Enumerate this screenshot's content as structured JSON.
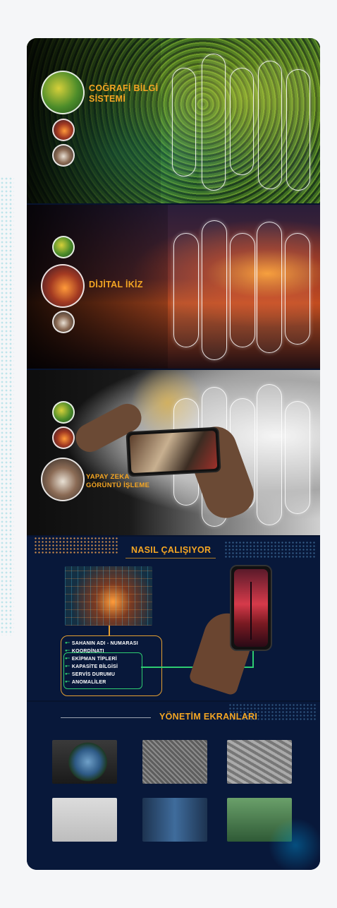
{
  "panels": [
    {
      "title_line1": "COĞRAFİ BİLGİ",
      "title_line2": "SİSTEMİ"
    },
    {
      "title_line1": "DİJİTAL İKİZ"
    },
    {
      "title_line1": "YAPAY ZEKA",
      "title_line2": "GÖRÜNTÜ İŞLEME"
    }
  ],
  "how_it_works": {
    "title": "NASIL ÇALIŞIYOR",
    "items": [
      "SAHANIN ADI - NUMARASI",
      "KOORDİNATI",
      "EKİPMAN TİPLERİ",
      "KAPASİTE BİLGİSİ",
      "SERVİS DURUMU",
      "ANOMALİLER"
    ]
  },
  "management": {
    "title": "YÖNETİM EKRANLARI"
  },
  "colors": {
    "accent": "#f5a623",
    "navy": "#08183a",
    "green": "#2ecc71"
  },
  "icons": [
    "bullet-connector-icon",
    "tower-icon",
    "phone-icon"
  ]
}
